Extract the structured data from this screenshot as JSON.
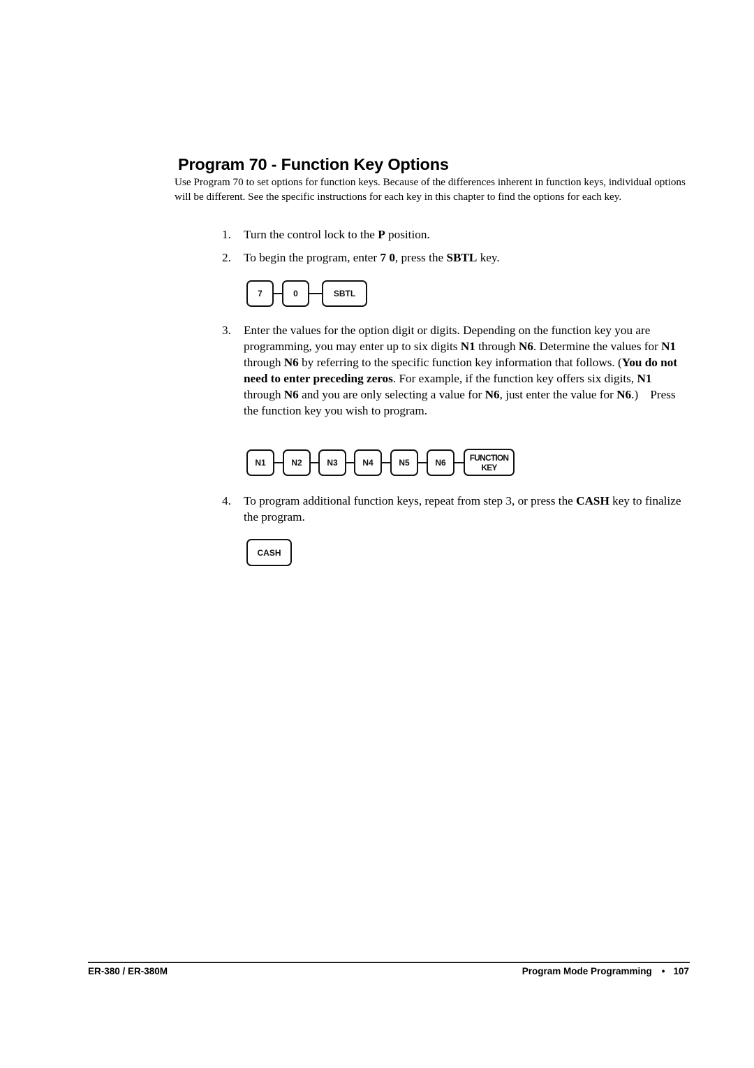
{
  "title": "Program 70 - Function Key Options",
  "intro": "Use Program 70 to set options for function keys. Because of the differences inherent in function keys, individual options will be different. See the specific instructions for each key in this chapter to find the options for each key.",
  "steps": [
    {
      "num": "1.",
      "parts": [
        {
          "text": "Turn the control lock to the ",
          "bold": false
        },
        {
          "text": "P",
          "bold": true
        },
        {
          "text": " position.",
          "bold": false
        }
      ]
    },
    {
      "num": "2.",
      "parts": [
        {
          "text": "To begin the program, enter ",
          "bold": false
        },
        {
          "text": "7 0",
          "bold": true
        },
        {
          "text": ", press the ",
          "bold": false
        },
        {
          "text": "SBTL",
          "bold": true
        },
        {
          "text": " key.",
          "bold": false
        }
      ]
    },
    {
      "num": "3.",
      "parts": [
        {
          "text": "Enter the values for the option digit or digits. Depending on the function key you are programming, you may enter up to six digits ",
          "bold": false
        },
        {
          "text": "N1",
          "bold": true
        },
        {
          "text": " through ",
          "bold": false
        },
        {
          "text": "N6",
          "bold": true
        },
        {
          "text": ". Determine the values for ",
          "bold": false
        },
        {
          "text": "N1",
          "bold": true
        },
        {
          "text": " through ",
          "bold": false
        },
        {
          "text": "N6",
          "bold": true
        },
        {
          "text": " by referring to the specific function key information that follows. (",
          "bold": false
        },
        {
          "text": "You do not need to enter preceding zeros",
          "bold": true
        },
        {
          "text": ". For example, if the function key offers six digits, ",
          "bold": false
        },
        {
          "text": "N1",
          "bold": true
        },
        {
          "text": " through ",
          "bold": false
        },
        {
          "text": "N6",
          "bold": true
        },
        {
          "text": " and you are only selecting a value for ",
          "bold": false
        },
        {
          "text": "N6",
          "bold": true
        },
        {
          "text": ", just enter the value for ",
          "bold": false
        },
        {
          "text": "N6",
          "bold": true
        },
        {
          "text": ".)    Press the function key you wish to program.",
          "bold": false
        }
      ]
    },
    {
      "num": "4.",
      "parts": [
        {
          "text": "To program additional function keys, repeat from step 3, or press the ",
          "bold": false
        },
        {
          "text": "CASH",
          "bold": true
        },
        {
          "text": " key to finalize the program.",
          "bold": false
        }
      ]
    }
  ],
  "key_sequences": {
    "start": [
      "7",
      "0",
      "SBTL"
    ],
    "options": [
      "N1",
      "N2",
      "N3",
      "N4",
      "N5",
      "N6",
      "FUNCTION KEY"
    ],
    "finish": [
      "CASH"
    ]
  },
  "footer": {
    "model": "ER-380 / ER-380M",
    "section": "Program Mode Programming",
    "bullet": "•",
    "page": "107"
  }
}
